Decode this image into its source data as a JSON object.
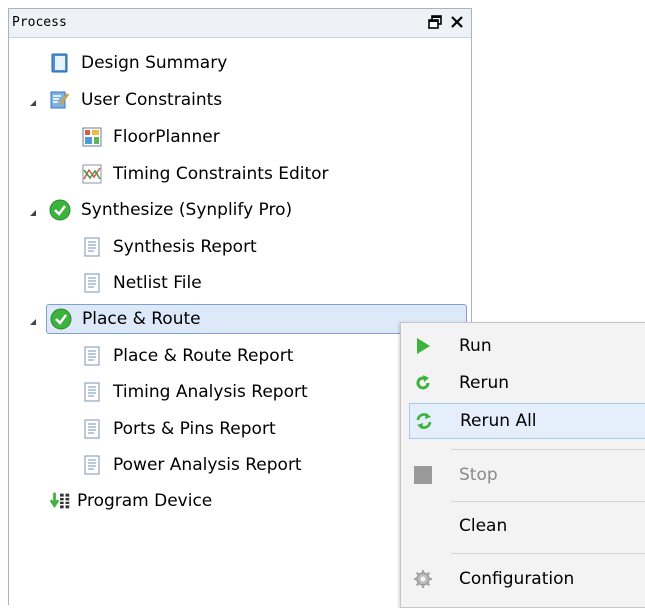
{
  "panel": {
    "title": "Process"
  },
  "tree": {
    "items": [
      {
        "label": "Design Summary",
        "icon": "design-summary-icon"
      },
      {
        "label": "User Constraints",
        "icon": "user-constraints-icon",
        "expanded": true
      },
      {
        "label": "FloorPlanner",
        "icon": "floorplanner-icon"
      },
      {
        "label": "Timing Constraints Editor",
        "icon": "timing-editor-icon"
      },
      {
        "label": "Synthesize (Synplify Pro)",
        "icon": "check-circle-icon",
        "expanded": true
      },
      {
        "label": "Synthesis Report",
        "icon": "report-icon"
      },
      {
        "label": "Netlist File",
        "icon": "report-icon"
      },
      {
        "label": "Place & Route",
        "icon": "check-circle-icon",
        "expanded": true,
        "selected": true
      },
      {
        "label": "Place & Route Report",
        "icon": "report-icon"
      },
      {
        "label": "Timing Analysis Report",
        "icon": "report-icon"
      },
      {
        "label": "Ports & Pins Report",
        "icon": "report-icon"
      },
      {
        "label": "Power Analysis Report",
        "icon": "report-icon"
      },
      {
        "label": "Program Device",
        "icon": "program-device-icon"
      }
    ]
  },
  "context_menu": {
    "items": [
      {
        "label": "Run",
        "icon": "play-icon"
      },
      {
        "label": "Rerun",
        "icon": "rerun-icon"
      },
      {
        "label": "Rerun All",
        "icon": "rerun-all-icon",
        "hovered": true
      },
      {
        "label": "Stop",
        "icon": "stop-icon",
        "disabled": true
      },
      {
        "label": "Clean",
        "icon": ""
      },
      {
        "label": "Configuration",
        "icon": "gear-icon"
      }
    ]
  },
  "colors": {
    "accent_green": "#3cb33c",
    "selection_bg": "#dde9f8",
    "selection_border": "#7da2ce"
  }
}
